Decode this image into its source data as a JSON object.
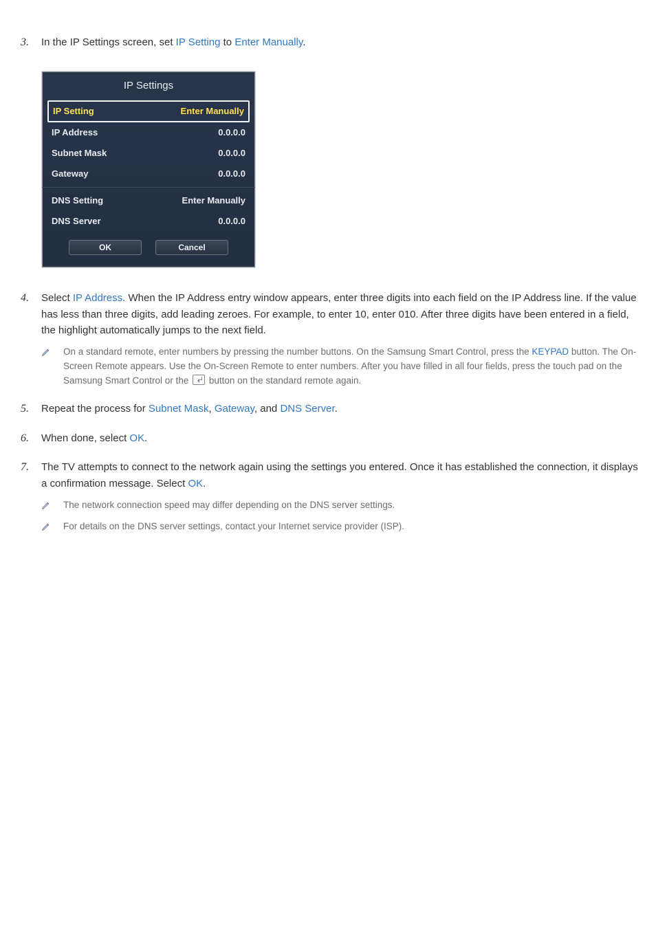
{
  "steps": {
    "s3": {
      "num": "3.",
      "pre": "In the IP Settings screen, set ",
      "hl1": "IP Setting",
      "mid": " to ",
      "hl2": "Enter Manually",
      "post": "."
    },
    "s4": {
      "num": "4.",
      "pre": "Select ",
      "hl1": "IP Address",
      "post": ". When the IP Address entry window appears, enter three digits into each field on the IP Address line. If the value has less than three digits, add leading zeroes. For example, to enter 10, enter 010. After three digits have been entered in a field, the highlight automatically jumps to the next field.",
      "note": {
        "pre": "On a standard remote, enter numbers by pressing the number buttons. On the Samsung Smart Control, press the ",
        "hl1": "KEYPAD",
        "mid": " button. The On-Screen Remote appears. Use the On-Screen Remote to enter numbers. After you have filled in all four fields, press the touch pad on the Samsung Smart Control or the ",
        "post": " button on the standard remote again."
      }
    },
    "s5": {
      "num": "5.",
      "pre": "Repeat the process for ",
      "hl1": "Subnet Mask",
      "sep1": ", ",
      "hl2": "Gateway",
      "sep2": ", and ",
      "hl3": "DNS Server",
      "post": "."
    },
    "s6": {
      "num": "6.",
      "pre": "When done, select ",
      "hl1": "OK",
      "post": "."
    },
    "s7": {
      "num": "7.",
      "pre": "The TV attempts to connect to the network again using the settings you entered. Once it has established the connection, it displays a confirmation message. Select ",
      "hl1": "OK",
      "post": ".",
      "note1": "The network connection speed may differ depending on the DNS server settings.",
      "note2": "For details on the DNS server settings, contact your Internet service provider (ISP)."
    }
  },
  "panel": {
    "title": "IP Settings",
    "rows": {
      "ip_setting": {
        "label": "IP Setting",
        "value": "Enter Manually"
      },
      "ip_address": {
        "label": "IP Address",
        "value": "0.0.0.0"
      },
      "subnet_mask": {
        "label": "Subnet Mask",
        "value": "0.0.0.0"
      },
      "gateway": {
        "label": "Gateway",
        "value": "0.0.0.0"
      },
      "dns_setting": {
        "label": "DNS Setting",
        "value": "Enter Manually"
      },
      "dns_server": {
        "label": "DNS Server",
        "value": "0.0.0.0"
      }
    },
    "buttons": {
      "ok": "OK",
      "cancel": "Cancel"
    }
  }
}
